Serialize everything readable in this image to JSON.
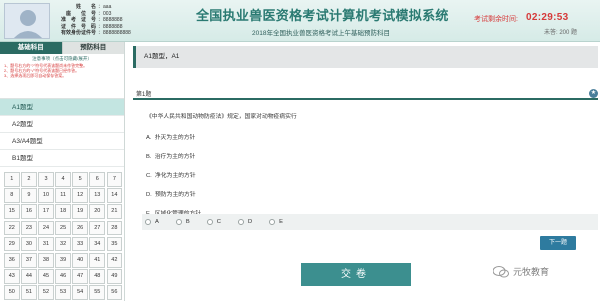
{
  "header": {
    "candidate": [
      {
        "label": "姓　　名",
        "value": "aaa"
      },
      {
        "label": "座　　位　号",
        "value": "003"
      },
      {
        "label": "准　考　证　号",
        "value": "8888888"
      },
      {
        "label": "证　件　号　码",
        "value": "8888888"
      },
      {
        "label": "有效身份证件号",
        "value": "8888888888"
      }
    ],
    "title": "全国执业兽医资格考试计算机考试模拟系统",
    "subtitle": "2018年全国执业兽医资格考试上午基础预防科目",
    "timer_label": "考试剩余时间:",
    "timer_value": "02:29:53",
    "unanswered": "未答: 200 题"
  },
  "left_panel": {
    "tabs": [
      {
        "label": "基础科目",
        "active": true
      },
      {
        "label": "预防科目",
        "active": false
      }
    ],
    "notice_heading": "注意事项（点击可隐藏/展开）",
    "notice_lines": [
      "1、题号右方的“?”符号代表该题尚未作答完整。",
      "2、题号右方的“√”符号代表该题已经作答。",
      "3、选择选项后即可自动保存答案。"
    ],
    "question_types": [
      {
        "label": "A1题型",
        "active": true
      },
      {
        "label": "A2题型",
        "active": false
      },
      {
        "label": "A3/A4题型",
        "active": false
      },
      {
        "label": "B1题型",
        "active": false
      }
    ],
    "grid_numbers": [
      "1",
      "2",
      "3",
      "4",
      "5",
      "6",
      "7",
      "8",
      "9",
      "10",
      "11",
      "12",
      "13",
      "14",
      "15",
      "16",
      "17",
      "18",
      "19",
      "20",
      "21",
      "22",
      "23",
      "24",
      "25",
      "26",
      "27",
      "28",
      "29",
      "30",
      "31",
      "32",
      "33",
      "34",
      "35",
      "36",
      "37",
      "38",
      "39",
      "40",
      "41",
      "42",
      "43",
      "44",
      "45",
      "46",
      "47",
      "48",
      "49",
      "50",
      "51",
      "52",
      "53",
      "54",
      "55",
      "56"
    ]
  },
  "main": {
    "section_title": "A1题型，A1",
    "question_number": "第1题",
    "stem": "《中华人民共和国动物防疫法》规定，国家对动物疫病实行",
    "options": [
      {
        "letter": "A.",
        "text": "扑灭为主的方针"
      },
      {
        "letter": "B.",
        "text": "治疗为主的方针"
      },
      {
        "letter": "C.",
        "text": "净化为主的方针"
      },
      {
        "letter": "D.",
        "text": "预防为主的方针"
      },
      {
        "letter": "E.",
        "text": "区域化管理的方针"
      }
    ],
    "radio_labels": [
      "A",
      "B",
      "C",
      "D",
      "E"
    ],
    "next_label": "下一题",
    "submit_label": "交卷"
  },
  "watermark": {
    "text": "元牧教育"
  },
  "colors": {
    "accent": "#2b6b63",
    "title": "#2a7a72",
    "timer": "#d63a3a",
    "button": "#2e7b9f",
    "submit": "#3c8f8f"
  }
}
